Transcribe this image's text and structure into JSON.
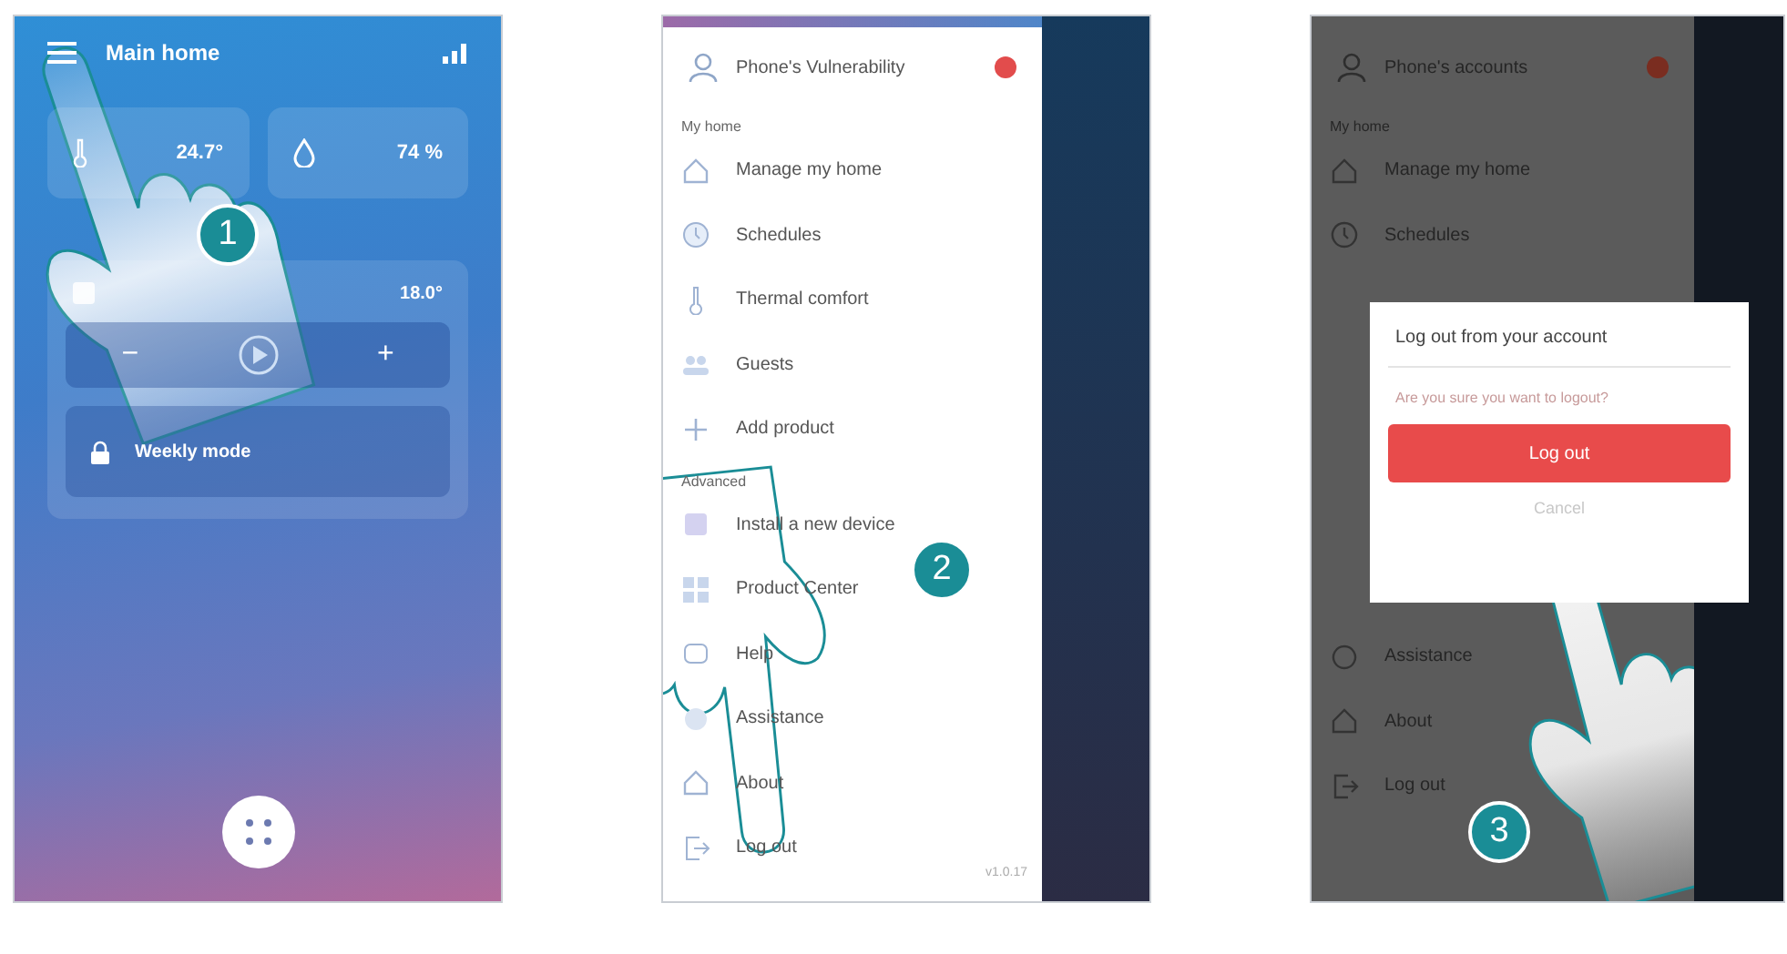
{
  "step_1": {
    "step": "1",
    "header": {
      "title": "Main home"
    },
    "tiles": [
      {
        "kind": "temperature",
        "value": "24.7°"
      },
      {
        "kind": "humidity",
        "value": "74 %"
      }
    ],
    "zone": {
      "value": "18.0°",
      "minus": "−",
      "plus": "+"
    },
    "mode": {
      "title": "Weekly mode"
    }
  },
  "step_2": {
    "step": "2",
    "user": "Phone's Vulnerability",
    "sections": [
      {
        "title": "My home",
        "items": [
          {
            "kind": "home",
            "label": "Manage my home"
          },
          {
            "kind": "clock",
            "label": "Schedules"
          },
          {
            "kind": "thermometer",
            "label": "Thermal comfort"
          },
          {
            "kind": "guests",
            "label": "Guests"
          },
          {
            "kind": "plus",
            "label": "Add product"
          }
        ]
      },
      {
        "title": "Advanced",
        "items": [
          {
            "kind": "device",
            "label": "Install a new device"
          },
          {
            "kind": "grid",
            "label": "Product Center"
          },
          {
            "kind": "chat",
            "label": "Help"
          },
          {
            "kind": "circle",
            "label": "Assistance"
          },
          {
            "kind": "home",
            "label": "About"
          },
          {
            "kind": "exit",
            "label": "Log out"
          }
        ]
      }
    ],
    "version": "v1.0.17"
  },
  "step_3": {
    "step": "3",
    "user": "Phone's accounts",
    "top_section": {
      "title": "My home",
      "items": [
        {
          "kind": "home",
          "label": "Manage my home"
        },
        {
          "kind": "clock",
          "label": "Schedules"
        }
      ]
    },
    "bottom_items": [
      {
        "kind": "circle",
        "label": "Assistance"
      },
      {
        "kind": "home",
        "label": "About"
      },
      {
        "kind": "exit",
        "label": "Log out"
      }
    ],
    "dialog": {
      "title": "Log out from your account",
      "message": "Are you sure you want to logout?",
      "confirm": "Log out",
      "cancel": "Cancel"
    }
  }
}
